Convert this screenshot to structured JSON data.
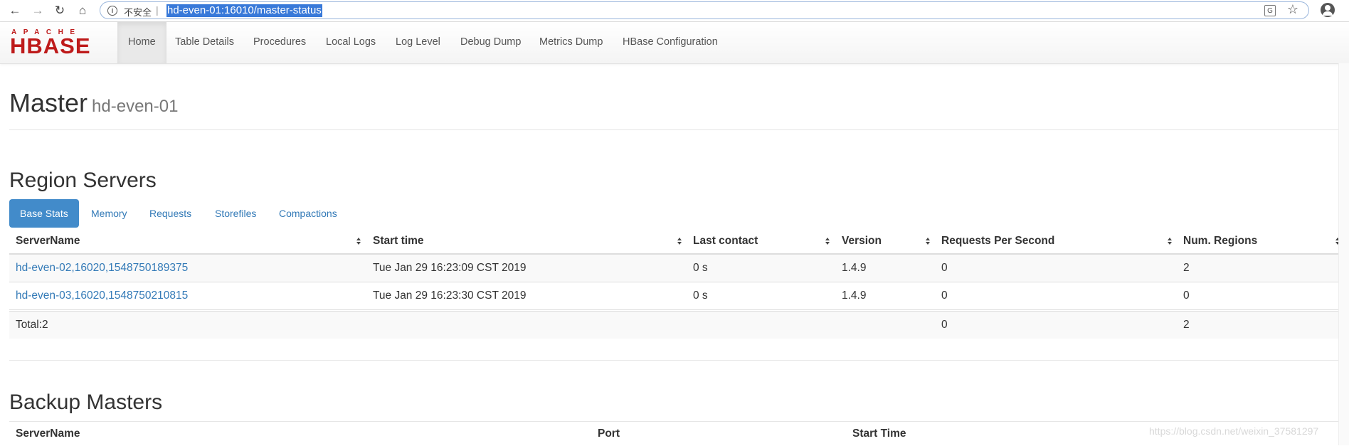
{
  "browser": {
    "insecure_label": "不安全",
    "url": "hd-even-01:16010/master-status"
  },
  "navbar": {
    "logo_top": "APACHE",
    "logo_main": "HBASE",
    "items": [
      {
        "label": "Home"
      },
      {
        "label": "Table Details"
      },
      {
        "label": "Procedures"
      },
      {
        "label": "Local Logs"
      },
      {
        "label": "Log Level"
      },
      {
        "label": "Debug Dump"
      },
      {
        "label": "Metrics Dump"
      },
      {
        "label": "HBase Configuration"
      }
    ]
  },
  "page": {
    "title": "Master",
    "host": "hd-even-01"
  },
  "region_servers": {
    "heading": "Region Servers",
    "tabs": [
      {
        "label": "Base Stats"
      },
      {
        "label": "Memory"
      },
      {
        "label": "Requests"
      },
      {
        "label": "Storefiles"
      },
      {
        "label": "Compactions"
      }
    ],
    "columns": [
      "ServerName",
      "Start time",
      "Last contact",
      "Version",
      "Requests Per Second",
      "Num. Regions"
    ],
    "rows": [
      {
        "server": "hd-even-02,16020,1548750189375",
        "start": "Tue Jan 29 16:23:09 CST 2019",
        "contact": "0 s",
        "version": "1.4.9",
        "rps": "0",
        "regions": "2"
      },
      {
        "server": "hd-even-03,16020,1548750210815",
        "start": "Tue Jan 29 16:23:30 CST 2019",
        "contact": "0 s",
        "version": "1.4.9",
        "rps": "0",
        "regions": "0"
      }
    ],
    "total": {
      "label": "Total:2",
      "rps": "0",
      "regions": "2"
    }
  },
  "backup_masters": {
    "heading": "Backup Masters",
    "columns": [
      "ServerName",
      "Port",
      "Start Time"
    ]
  },
  "watermark": "https://blog.csdn.net/weixin_37581297"
}
